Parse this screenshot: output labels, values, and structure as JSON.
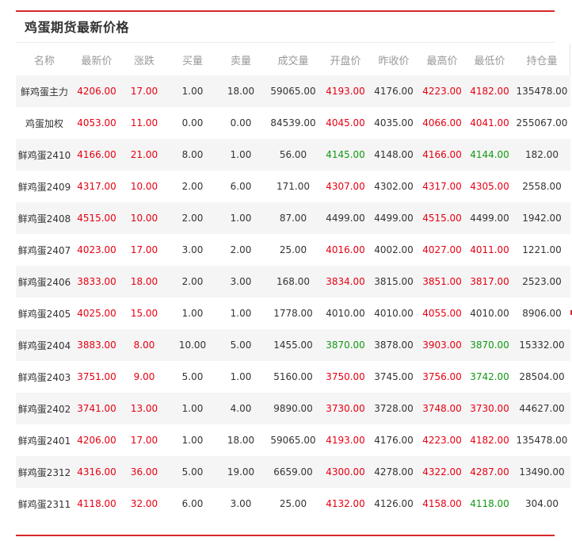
{
  "panel": {
    "title": "鸡蛋期货最新价格"
  },
  "colors": {
    "accent": "#d7282a",
    "up": "#e60012",
    "down": "#119911",
    "header_text": "#999999",
    "stripe": "#f5f5f5"
  },
  "table": {
    "columns": [
      "名称",
      "最新价",
      "涨跌",
      "买量",
      "卖量",
      "成交量",
      "开盘价",
      "昨收价",
      "最高价",
      "最低价",
      "持仓量"
    ],
    "rows": [
      {
        "name": "鲜鸡蛋主力",
        "last": "4206.00",
        "chg": "17.00",
        "bid": "1.00",
        "ask": "18.00",
        "vol": "59065.00",
        "open": "4193.00",
        "prev": "4176.00",
        "high": "4223.00",
        "low": "4182.00",
        "oi": "135478.00",
        "c": {
          "name": "flat",
          "last": "up",
          "chg": "up",
          "open": "up",
          "high": "up",
          "low": "up"
        }
      },
      {
        "name": "鸡蛋加权",
        "last": "4053.00",
        "chg": "11.00",
        "bid": "0.00",
        "ask": "0.00",
        "vol": "84539.00",
        "open": "4045.00",
        "prev": "4035.00",
        "high": "4066.00",
        "low": "4041.00",
        "oi": "255067.00",
        "c": {
          "name": "flat",
          "last": "up",
          "chg": "up",
          "open": "up",
          "high": "up",
          "low": "up"
        }
      },
      {
        "name": "鲜鸡蛋2410",
        "last": "4166.00",
        "chg": "21.00",
        "bid": "8.00",
        "ask": "1.00",
        "vol": "56.00",
        "open": "4145.00",
        "prev": "4148.00",
        "high": "4166.00",
        "low": "4144.00",
        "oi": "182.00",
        "c": {
          "name": "flat",
          "last": "up",
          "chg": "up",
          "open": "down",
          "high": "up",
          "low": "down"
        }
      },
      {
        "name": "鲜鸡蛋2409",
        "last": "4317.00",
        "chg": "10.00",
        "bid": "2.00",
        "ask": "6.00",
        "vol": "171.00",
        "open": "4307.00",
        "prev": "4302.00",
        "high": "4317.00",
        "low": "4305.00",
        "oi": "2558.00",
        "c": {
          "name": "flat",
          "last": "up",
          "chg": "up",
          "open": "up",
          "high": "up",
          "low": "up"
        }
      },
      {
        "name": "鲜鸡蛋2408",
        "last": "4515.00",
        "chg": "10.00",
        "bid": "2.00",
        "ask": "1.00",
        "vol": "87.00",
        "open": "4499.00",
        "prev": "4499.00",
        "high": "4515.00",
        "low": "4499.00",
        "oi": "1942.00",
        "c": {
          "name": "flat",
          "last": "up",
          "chg": "up",
          "open": "flat",
          "high": "up",
          "low": "flat"
        }
      },
      {
        "name": "鲜鸡蛋2407",
        "last": "4023.00",
        "chg": "17.00",
        "bid": "3.00",
        "ask": "2.00",
        "vol": "25.00",
        "open": "4016.00",
        "prev": "4002.00",
        "high": "4027.00",
        "low": "4011.00",
        "oi": "1221.00",
        "c": {
          "name": "flat",
          "last": "up",
          "chg": "up",
          "open": "up",
          "high": "up",
          "low": "up"
        }
      },
      {
        "name": "鲜鸡蛋2406",
        "last": "3833.00",
        "chg": "18.00",
        "bid": "2.00",
        "ask": "3.00",
        "vol": "168.00",
        "open": "3834.00",
        "prev": "3815.00",
        "high": "3851.00",
        "low": "3817.00",
        "oi": "2523.00",
        "c": {
          "name": "flat",
          "last": "up",
          "chg": "up",
          "open": "up",
          "high": "up",
          "low": "up"
        }
      },
      {
        "name": "鲜鸡蛋2405",
        "last": "4025.00",
        "chg": "15.00",
        "bid": "1.00",
        "ask": "1.00",
        "vol": "1778.00",
        "open": "4010.00",
        "prev": "4010.00",
        "high": "4055.00",
        "low": "4010.00",
        "oi": "8906.00",
        "c": {
          "name": "flat",
          "last": "up",
          "chg": "up",
          "open": "flat",
          "high": "up",
          "low": "flat"
        }
      },
      {
        "name": "鲜鸡蛋2404",
        "last": "3883.00",
        "chg": "8.00",
        "bid": "10.00",
        "ask": "5.00",
        "vol": "1455.00",
        "open": "3870.00",
        "prev": "3878.00",
        "high": "3903.00",
        "low": "3870.00",
        "oi": "15332.00",
        "c": {
          "name": "flat",
          "last": "up",
          "chg": "up",
          "open": "down",
          "high": "up",
          "low": "down"
        }
      },
      {
        "name": "鲜鸡蛋2403",
        "last": "3751.00",
        "chg": "9.00",
        "bid": "5.00",
        "ask": "1.00",
        "vol": "5160.00",
        "open": "3750.00",
        "prev": "3745.00",
        "high": "3756.00",
        "low": "3742.00",
        "oi": "28504.00",
        "c": {
          "name": "flat",
          "last": "up",
          "chg": "up",
          "open": "up",
          "high": "up",
          "low": "down"
        }
      },
      {
        "name": "鲜鸡蛋2402",
        "last": "3741.00",
        "chg": "13.00",
        "bid": "1.00",
        "ask": "4.00",
        "vol": "9890.00",
        "open": "3730.00",
        "prev": "3728.00",
        "high": "3748.00",
        "low": "3730.00",
        "oi": "44627.00",
        "c": {
          "name": "flat",
          "last": "up",
          "chg": "up",
          "open": "up",
          "high": "up",
          "low": "up"
        }
      },
      {
        "name": "鲜鸡蛋2401",
        "last": "4206.00",
        "chg": "17.00",
        "bid": "1.00",
        "ask": "18.00",
        "vol": "59065.00",
        "open": "4193.00",
        "prev": "4176.00",
        "high": "4223.00",
        "low": "4182.00",
        "oi": "135478.00",
        "c": {
          "name": "flat",
          "last": "up",
          "chg": "up",
          "open": "up",
          "high": "up",
          "low": "up"
        }
      },
      {
        "name": "鲜鸡蛋2312",
        "last": "4316.00",
        "chg": "36.00",
        "bid": "5.00",
        "ask": "19.00",
        "vol": "6659.00",
        "open": "4300.00",
        "prev": "4278.00",
        "high": "4322.00",
        "low": "4287.00",
        "oi": "13490.00",
        "c": {
          "name": "flat",
          "last": "up",
          "chg": "up",
          "open": "up",
          "high": "up",
          "low": "up"
        }
      },
      {
        "name": "鲜鸡蛋2311",
        "last": "4118.00",
        "chg": "32.00",
        "bid": "6.00",
        "ask": "3.00",
        "vol": "25.00",
        "open": "4132.00",
        "prev": "4126.00",
        "high": "4158.00",
        "low": "4118.00",
        "oi": "304.00",
        "c": {
          "name": "flat",
          "last": "up",
          "chg": "up",
          "open": "up",
          "high": "up",
          "low": "down"
        }
      }
    ]
  }
}
